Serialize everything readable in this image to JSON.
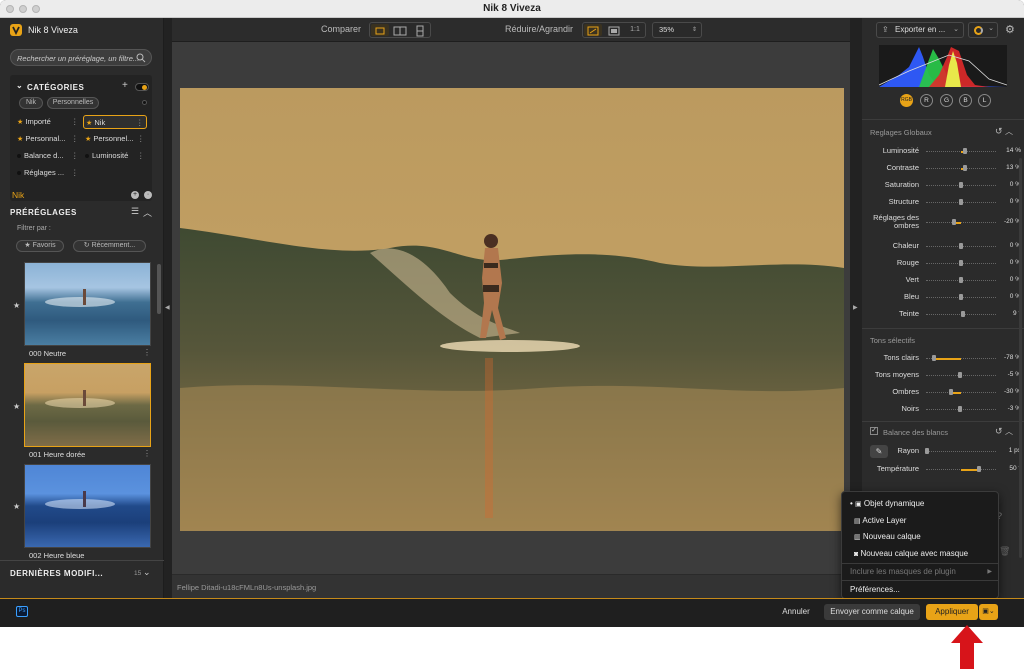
{
  "window": {
    "title": "Nik 8 Viveza"
  },
  "app": {
    "name": "Nik 8 Viveza"
  },
  "search": {
    "placeholder": "Rechercher un préréglage, un filtre..."
  },
  "categories": {
    "title": "CATÉGORIES",
    "tags": [
      "Nik",
      "Personnelles"
    ],
    "items": [
      {
        "label": "Importé",
        "starred": true,
        "selected": false
      },
      {
        "label": "Nik",
        "starred": true,
        "selected": true
      },
      {
        "label": "Personnal...",
        "starred": true,
        "selected": false
      },
      {
        "label": "Personnel...",
        "starred": true,
        "selected": false
      },
      {
        "label": "Balance d...",
        "starred": false,
        "selected": false
      },
      {
        "label": "Luminosité",
        "starred": false,
        "selected": false
      },
      {
        "label": "Réglages ...",
        "starred": false,
        "selected": false
      }
    ]
  },
  "current_category": "Nik",
  "presets": {
    "title": "PRÉRÉGLAGES",
    "filter_label": "Filtrer par :",
    "filters": [
      "★ Favoris",
      "↻ Récemment..."
    ],
    "items": [
      {
        "label": "000 Neutre"
      },
      {
        "label": "001 Heure dorée"
      },
      {
        "label": "002 Heure bleue"
      }
    ]
  },
  "recent": {
    "title": "DERNIÈRES MODIFI...",
    "count": "15"
  },
  "toolbar": {
    "compare_label": "Comparer",
    "zoom_label": "Réduire/Agrandir",
    "one_to_one": "1:1",
    "zoom_value": "35%"
  },
  "canvas": {
    "filename": "Fellipe Ditadi-u18cFMLn8Us-unsplash.jpg"
  },
  "export": {
    "label": "Exporter en ..."
  },
  "histogram": {
    "channels": [
      "RGB",
      "R",
      "G",
      "B",
      "L"
    ]
  },
  "global": {
    "title": "Reglages Globaux",
    "sliders": [
      {
        "label": "Luminosité",
        "value": "14 %",
        "pos": 0.56
      },
      {
        "label": "Contraste",
        "value": "13 %",
        "pos": 0.55
      },
      {
        "label": "Saturation",
        "value": "0 %",
        "pos": 0.5
      },
      {
        "label": "Structure",
        "value": "0 %",
        "pos": 0.5
      },
      {
        "label": "Réglages des ombres",
        "value": "-20 %",
        "pos": 0.4
      },
      {
        "label": "Chaleur",
        "value": "0 %",
        "pos": 0.5
      },
      {
        "label": "Rouge",
        "value": "0 %",
        "pos": 0.5
      },
      {
        "label": "Vert",
        "value": "0 %",
        "pos": 0.5
      },
      {
        "label": "Bleu",
        "value": "0 %",
        "pos": 0.5
      },
      {
        "label": "Teinte",
        "value": "9 °",
        "pos": 0.53
      }
    ]
  },
  "selective": {
    "title": "Tons sélectifs",
    "sliders": [
      {
        "label": "Tons clairs",
        "value": "-78 %",
        "pos": 0.11
      },
      {
        "label": "Tons moyens",
        "value": "-5 %",
        "pos": 0.48
      },
      {
        "label": "Ombres",
        "value": "-30 %",
        "pos": 0.35
      },
      {
        "label": "Noirs",
        "value": "-3 %",
        "pos": 0.49
      }
    ]
  },
  "white_balance": {
    "title": "Balance des blancs",
    "sliders": [
      {
        "label": "Rayon",
        "value": "1 px",
        "pos": 0.02
      },
      {
        "label": "Température",
        "value": "50 °",
        "pos": 0.75
      }
    ]
  },
  "dropdown": {
    "items": [
      "Objet dynamique",
      "Active Layer",
      "Nouveau calque",
      "Nouveau calque avec masque"
    ],
    "disabled_item": "Inclure les masques de plugin",
    "prefs": "Préférences..."
  },
  "footer": {
    "ps": "Ps",
    "cancel": "Annuler",
    "send_layer": "Envoyer comme calque",
    "apply": "Appliquer"
  },
  "colors": {
    "accent": "#e8a317",
    "annotation_arrow": "#d7141a"
  }
}
